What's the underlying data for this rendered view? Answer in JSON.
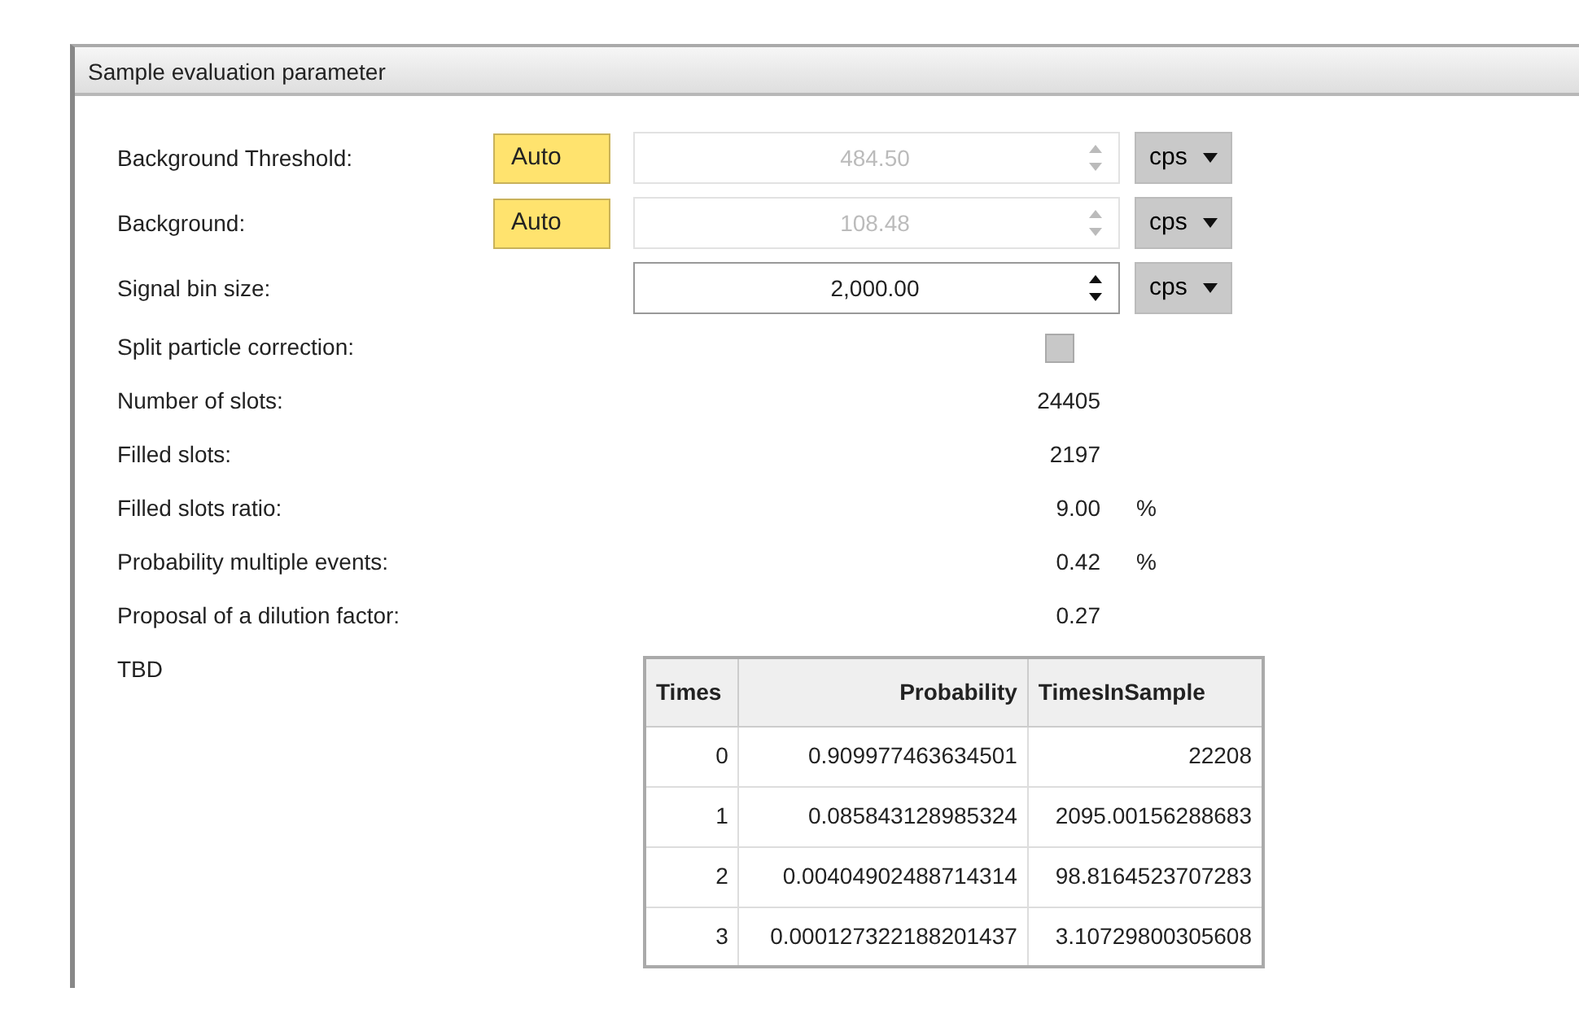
{
  "panel": {
    "title": "Sample evaluation parameter"
  },
  "params": [
    {
      "kind": "auto",
      "label": "Background Threshold:",
      "button": "Auto",
      "value": "484.50",
      "disabled": true,
      "unit": "cps"
    },
    {
      "kind": "auto",
      "label": "Background:",
      "button": "Auto",
      "value": "108.48",
      "disabled": true,
      "unit": "cps"
    },
    {
      "kind": "spin",
      "label": "Signal bin size:",
      "value": "2,000.00",
      "disabled": false,
      "unit": "cps"
    },
    {
      "kind": "checkbox",
      "label": "Split particle correction:",
      "checked": false
    },
    {
      "kind": "value",
      "label": "Number of slots:",
      "value": "24405"
    },
    {
      "kind": "value",
      "label": "Filled slots:",
      "value": "2197"
    },
    {
      "kind": "value",
      "label": "Filled slots ratio:",
      "value": "9.00",
      "unit": "%"
    },
    {
      "kind": "value",
      "label": "Probability multiple events:",
      "value": "0.42",
      "unit": "%"
    },
    {
      "kind": "value",
      "label": "Proposal of a dilution factor:",
      "value": "0.27"
    },
    {
      "kind": "table",
      "label": "TBD"
    }
  ],
  "table": {
    "columns": [
      "Times",
      "Probability",
      "TimesInSample"
    ],
    "rows": [
      [
        "0",
        "0.909977463634501",
        "22208"
      ],
      [
        "1",
        "0.085843128985324",
        "2095.00156288683"
      ],
      [
        "2",
        "0.00404902488714314",
        "98.8164523707283"
      ],
      [
        "3",
        "0.000127322188201437",
        "3.10729800305608"
      ]
    ]
  }
}
